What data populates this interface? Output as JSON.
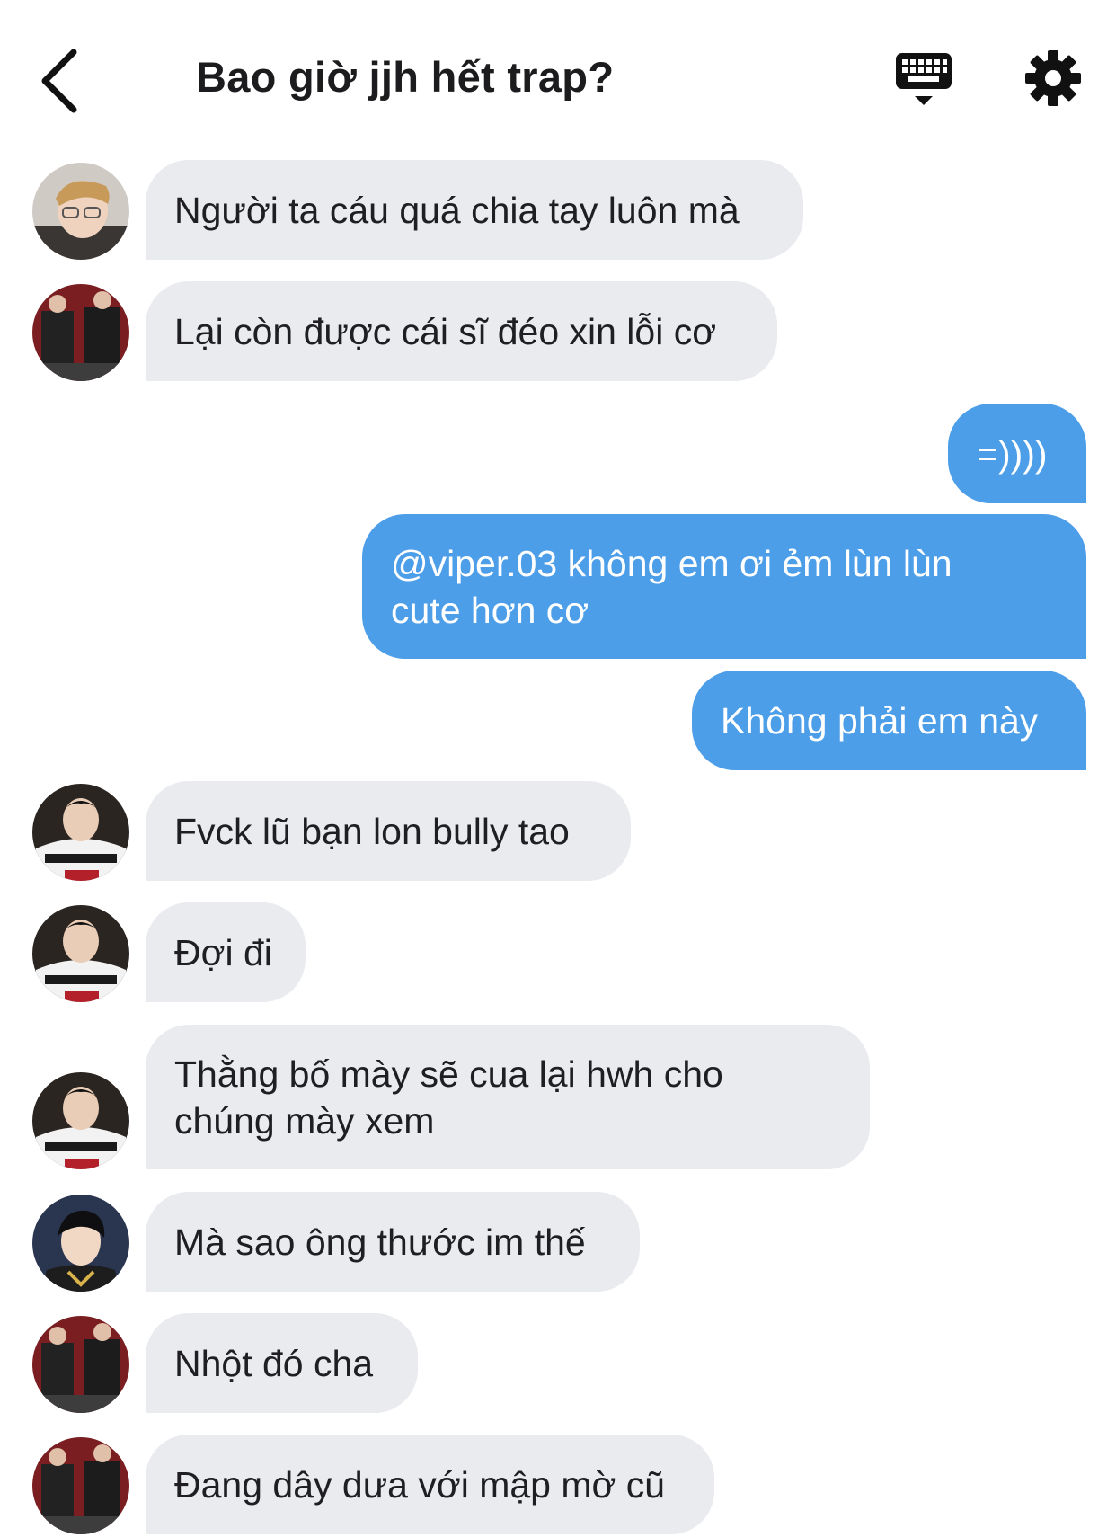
{
  "header": {
    "title": "Bao giờ jjh hết trap?",
    "back_icon": "chevron-left-icon",
    "keyboard_icon": "keyboard-icon",
    "settings_icon": "gear-icon"
  },
  "colors": {
    "incoming_bubble": "#e9ebef",
    "outgoing_bubble": "#4d9ee9",
    "title_text": "#1c1c1e"
  },
  "messages": [
    {
      "direction": "incoming",
      "text": "Người ta cáu quá chia tay luôn mà"
    },
    {
      "direction": "incoming",
      "text": "Lại còn được cái sĩ đéo xin lỗi cơ"
    },
    {
      "direction": "outgoing",
      "text": "=))))"
    },
    {
      "direction": "outgoing",
      "text": "@viper.03 không em ơi ẻm lùn lùn cute hơn cơ"
    },
    {
      "direction": "outgoing",
      "text": "Không phải em này"
    },
    {
      "direction": "incoming",
      "text": "Fvck lũ bạn lon bully tao"
    },
    {
      "direction": "incoming",
      "text": "Đợi đi"
    },
    {
      "direction": "incoming",
      "text": "Thằng bố mày sẽ cua lại hwh cho chúng mày xem"
    },
    {
      "direction": "incoming",
      "text": "Mà sao ông thước im thế"
    },
    {
      "direction": "incoming",
      "text": "Nhột đó cha"
    },
    {
      "direction": "incoming",
      "text": "Đang dây dưa với mập mờ cũ"
    }
  ]
}
